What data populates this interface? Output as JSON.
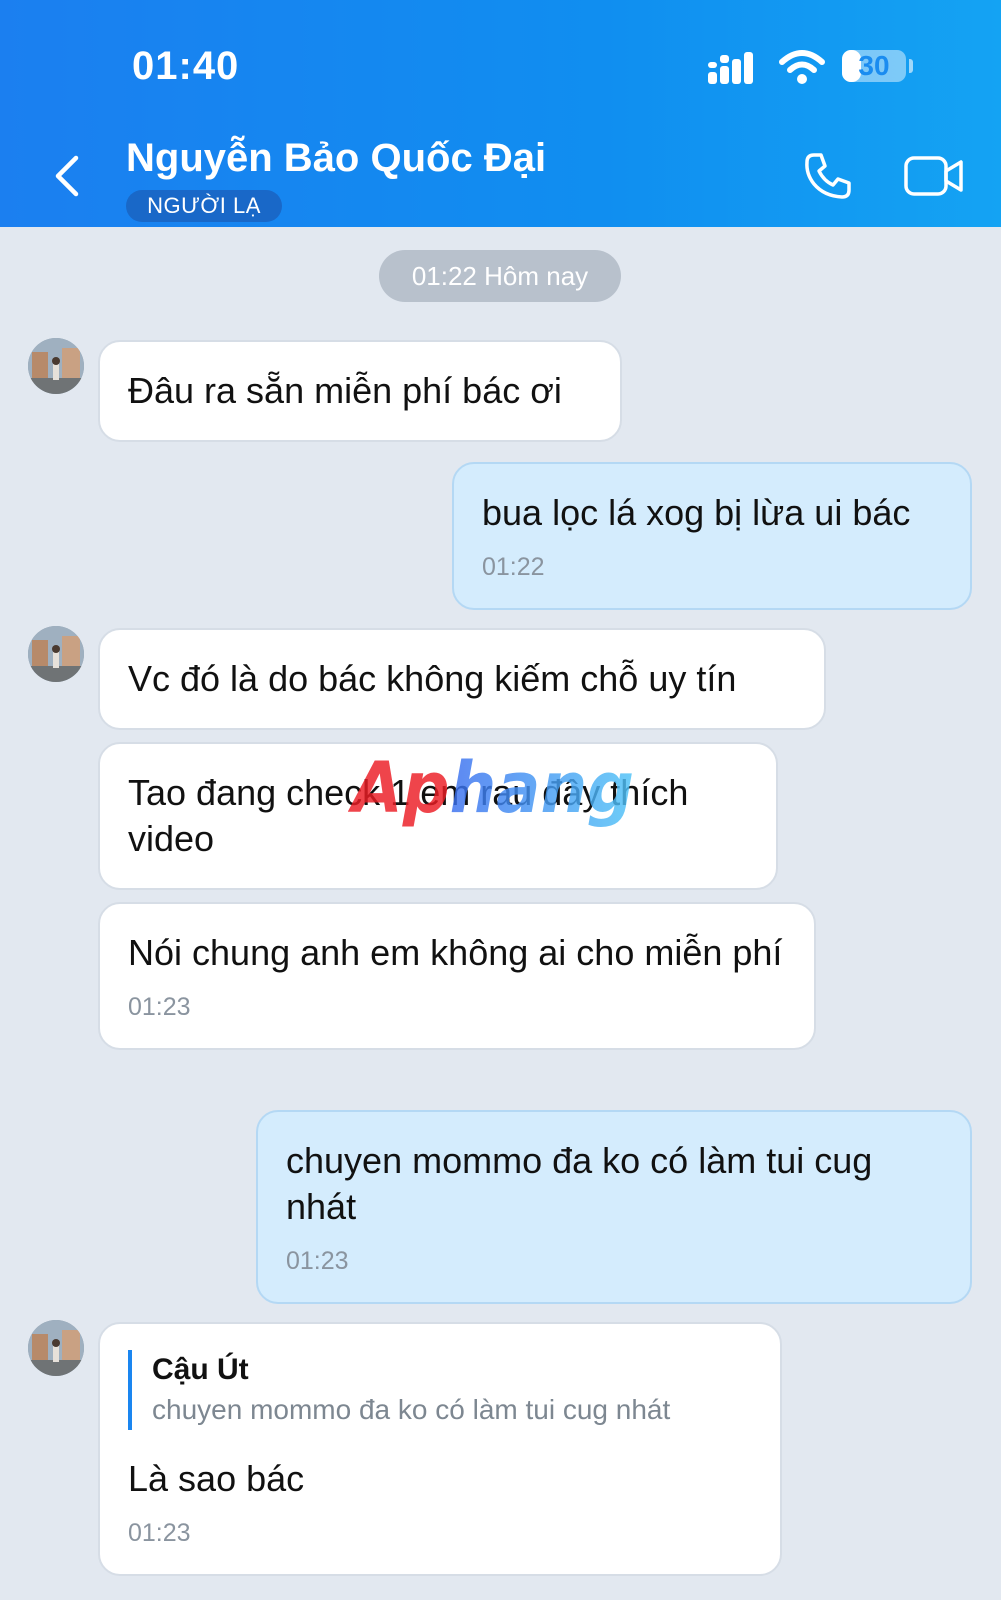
{
  "status_bar": {
    "time": "01:40",
    "battery": "30",
    "battery_level": 0.3
  },
  "header": {
    "contact_name": "Nguyễn Bảo Quốc Đại",
    "badge": "NGƯỜI LẠ"
  },
  "date_chip": "01:22 Hôm nay",
  "messages": [
    {
      "text": "Đâu ra sẵn miễn phí bác ơi",
      "time": ""
    },
    {
      "text": "bua lọc lá xog bị lừa ui bác",
      "time": "01:22"
    },
    {
      "text": "Vc đó là do bác không kiếm chỗ uy tín",
      "time": ""
    },
    {
      "text": "Tao đang check 1 em rau đây thích video",
      "time": ""
    },
    {
      "text": "Nói chung anh em không ai cho miễn phí",
      "time": "01:23"
    },
    {
      "text": "chuyen mommo đa ko có làm tui cug nhát",
      "time": "01:23"
    },
    {
      "quote_author": "Cậu Út",
      "quote_text": "chuyen mommo đa ko có làm tui cug nhát",
      "text": "Là sao bác",
      "time": "01:23"
    }
  ],
  "watermark": "Aphang",
  "colors": {
    "header_start": "#1b7ff0",
    "header_end": "#14a3f3",
    "incoming_bubble": "#ffffff",
    "outgoing_bubble": "#d4ecfd",
    "chat_background": "#e2e8f0",
    "badge": "#1968c8",
    "quote_bar": "#1a86f0"
  }
}
